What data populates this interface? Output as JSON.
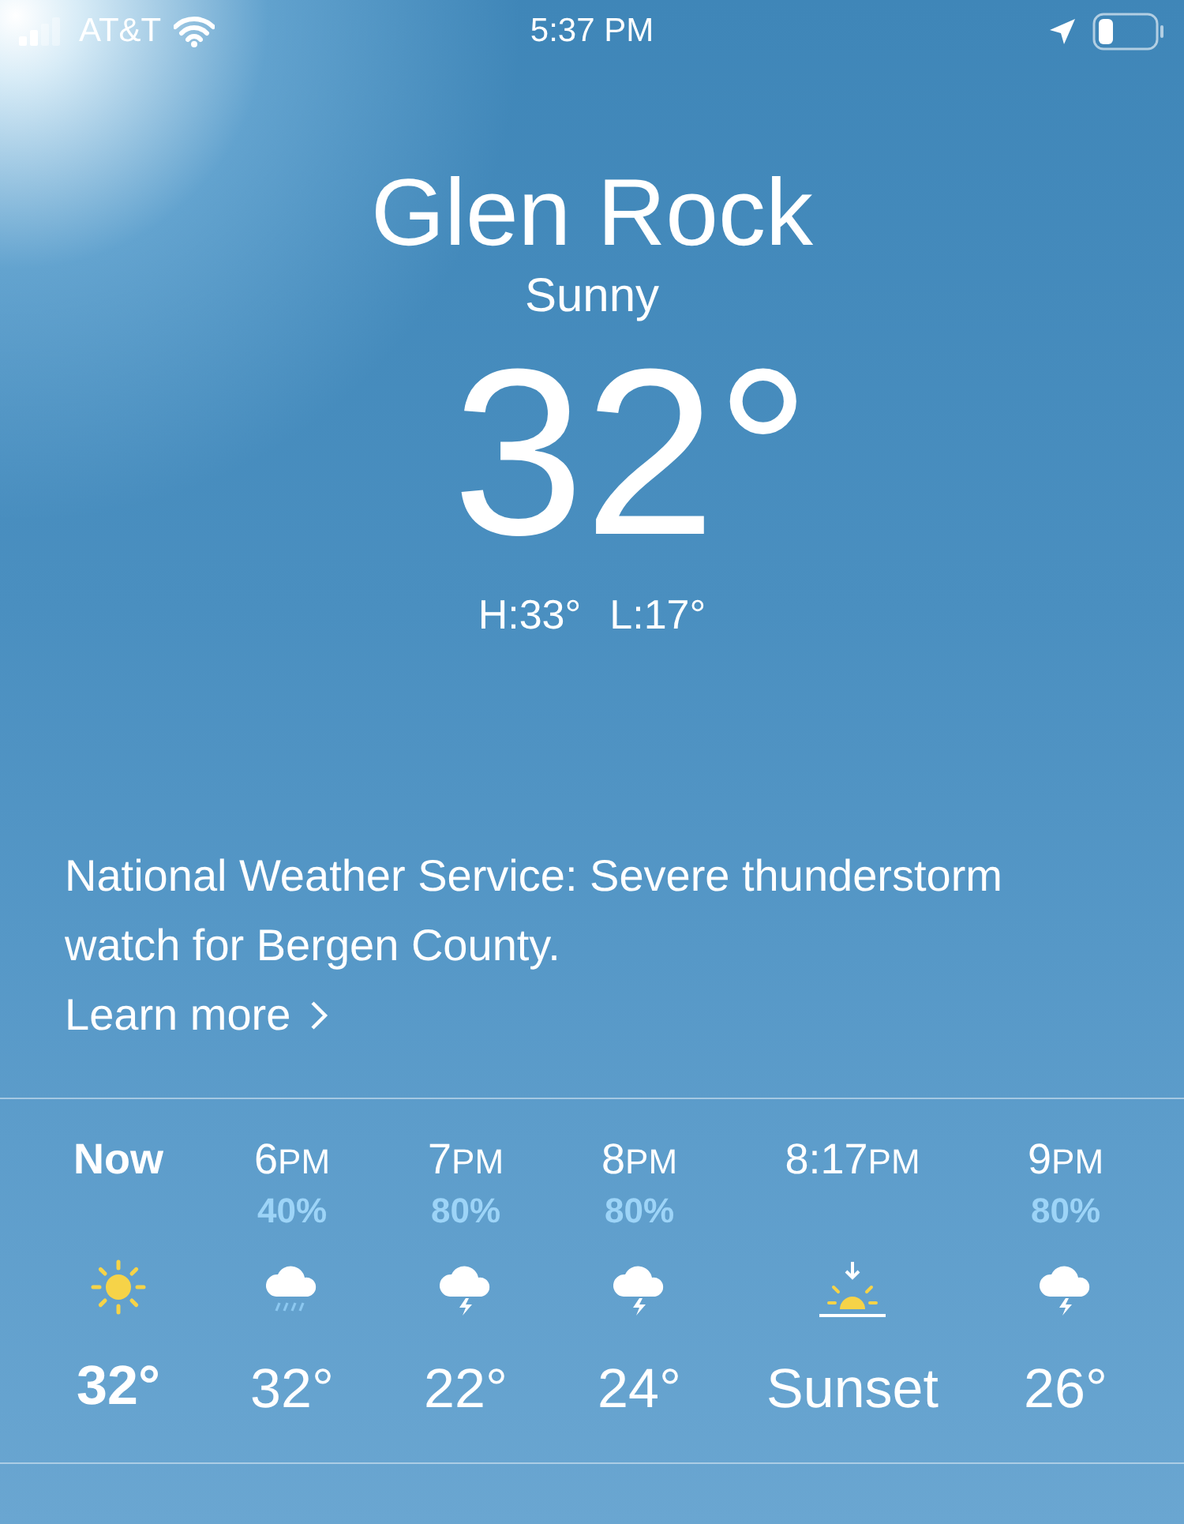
{
  "status_bar": {
    "carrier": "AT&T",
    "time": "5:37 PM"
  },
  "current": {
    "city": "Glen Rock",
    "condition": "Sunny",
    "temperature": "32°",
    "high": "H:33°",
    "low": "L:17°"
  },
  "alert": {
    "text": "National Weather Service: Severe thunderstorm watch for Bergen County.",
    "link": "Learn more"
  },
  "hourly": [
    {
      "kind": "clear",
      "now": true,
      "time": "Now",
      "temperature": "32°"
    },
    {
      "kind": "rain",
      "now": false,
      "time": "6",
      "suffix": "PM",
      "chance": "40%",
      "temperature": "32°"
    },
    {
      "kind": "storm",
      "now": false,
      "time": "7",
      "suffix": "PM",
      "chance": "80%",
      "temperature": "22°"
    },
    {
      "kind": "storm",
      "now": false,
      "time": "8",
      "suffix": "PM",
      "chance": "80%",
      "temperature": "24°"
    },
    {
      "kind": "sunset",
      "now": false,
      "time": "8:17",
      "suffix": "PM",
      "temperature": "Sunset"
    },
    {
      "kind": "storm",
      "now": false,
      "time": "9",
      "suffix": "PM",
      "chance": "80%",
      "temperature": "26°"
    }
  ]
}
